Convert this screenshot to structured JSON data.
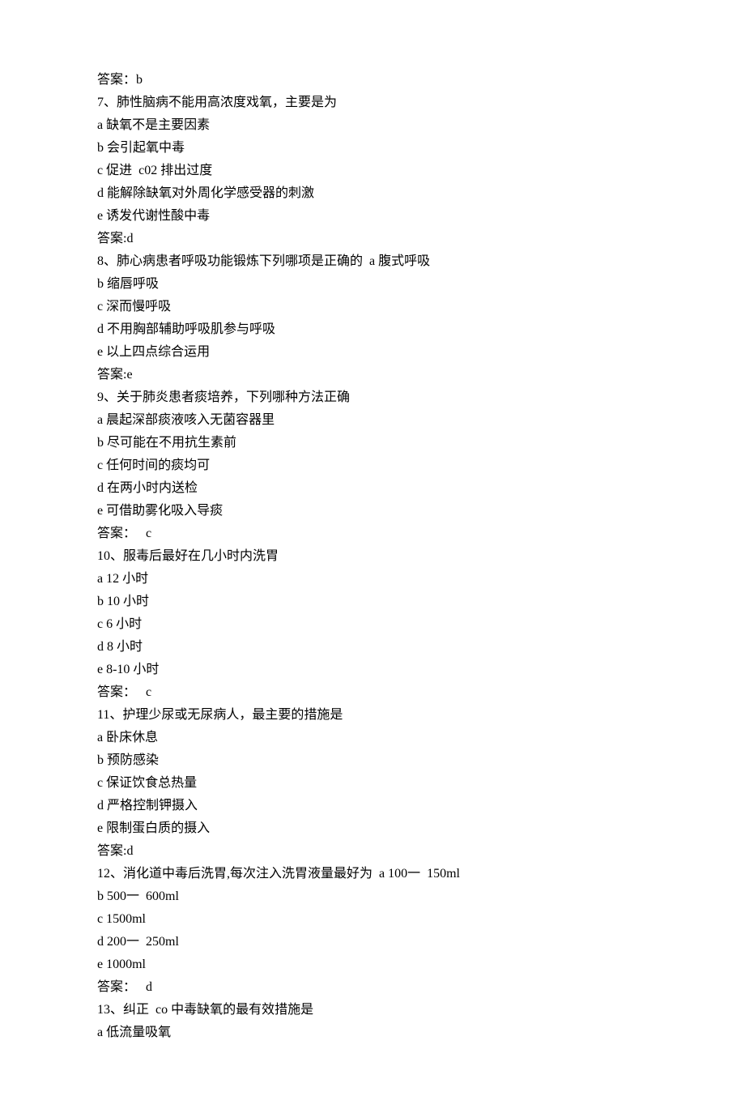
{
  "lines": [
    "答案：b",
    "7、肺性脑病不能用高浓度戏氧，主要是为",
    "a 缺氧不是主要因素",
    "b 会引起氧中毒",
    "c 促进  c02 排出过度",
    "d 能解除缺氧对外周化学感受器的刺激",
    "e 诱发代谢性酸中毒",
    "答案:d",
    "8、肺心病患者呼吸功能锻炼下列哪项是正确的  a 腹式呼吸",
    "b 缩唇呼吸",
    "c 深而慢呼吸",
    "d 不用胸部辅助呼吸肌参与呼吸",
    "e 以上四点综合运用",
    "答案:e",
    "9、关于肺炎患者痰培养，下列哪种方法正确",
    "a 晨起深部痰液咳入无菌容器里",
    "b 尽可能在不用抗生素前",
    "c 任何时间的痰均可",
    "d 在两小时内送检",
    "e 可借助雾化吸入导痰",
    "答案：   c",
    "10、服毒后最好在几小时内洗胃",
    "a 12 小时",
    "b 10 小时",
    "c 6 小时",
    "d 8 小时",
    "e 8-10 小时",
    "答案：   c",
    "11、护理少尿或无尿病人，最主要的措施是",
    "a 卧床休息",
    "b 预防感染",
    "c 保证饮食总热量",
    "d 严格控制钾摄入",
    "e 限制蛋白质的摄入",
    "答案:d",
    "12、消化道中毒后洗胃,每次注入洗胃液量最好为  a 100一  150ml",
    "b 500一  600ml",
    "c 1500ml",
    "d 200一  250ml",
    "e 1000ml",
    "答案：   d",
    "13、纠正  co 中毒缺氧的最有效措施是",
    "a 低流量吸氧"
  ]
}
